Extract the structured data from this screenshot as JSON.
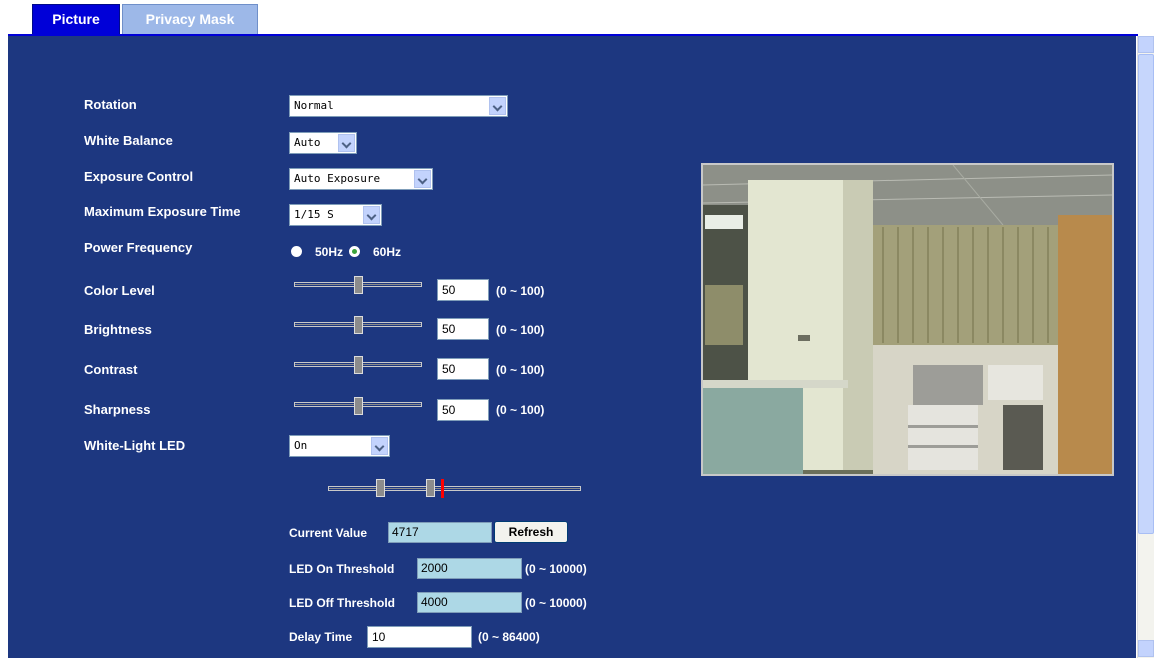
{
  "tabs": [
    {
      "label": "Picture",
      "active": true
    },
    {
      "label": "Privacy Mask",
      "active": false
    }
  ],
  "settings": {
    "rotation": {
      "label": "Rotation",
      "value": "Normal"
    },
    "white_balance": {
      "label": "White Balance",
      "value": "Auto"
    },
    "exposure_control": {
      "label": "Exposure Control",
      "value": "Auto Exposure"
    },
    "max_exposure": {
      "label": "Maximum Exposure Time",
      "value": "1/15 S"
    },
    "power_frequency": {
      "label": "Power Frequency",
      "options": [
        "50Hz",
        "60Hz"
      ],
      "selected": "60Hz"
    },
    "color_level": {
      "label": "Color Level",
      "value": "50",
      "range": "(0 ~ 100)"
    },
    "brightness": {
      "label": "Brightness",
      "value": "50",
      "range": "(0 ~ 100)"
    },
    "contrast": {
      "label": "Contrast",
      "value": "50",
      "range": "(0 ~ 100)"
    },
    "sharpness": {
      "label": "Sharpness",
      "value": "50",
      "range": "(0 ~ 100)"
    },
    "white_light_led": {
      "label": "White-Light LED",
      "value": "On"
    }
  },
  "led": {
    "current_value_label": "Current Value",
    "current_value": "4717",
    "refresh_label": "Refresh",
    "on_threshold_label": "LED On Threshold",
    "on_threshold": "2000",
    "on_threshold_range": "(0 ~ 10000)",
    "off_threshold_label": "LED Off Threshold",
    "off_threshold": "4000",
    "off_threshold_range": "(0 ~ 10000)",
    "delay_label": "Delay Time",
    "delay_value": "10",
    "delay_range": "(0 ~ 86400)"
  },
  "colors": {
    "panel_bg": "#1d3780",
    "active_tab": "#0000d8",
    "inactive_tab": "#9db8e8",
    "readonly_field": "#add8e6",
    "marker_red": "#ff0000"
  }
}
